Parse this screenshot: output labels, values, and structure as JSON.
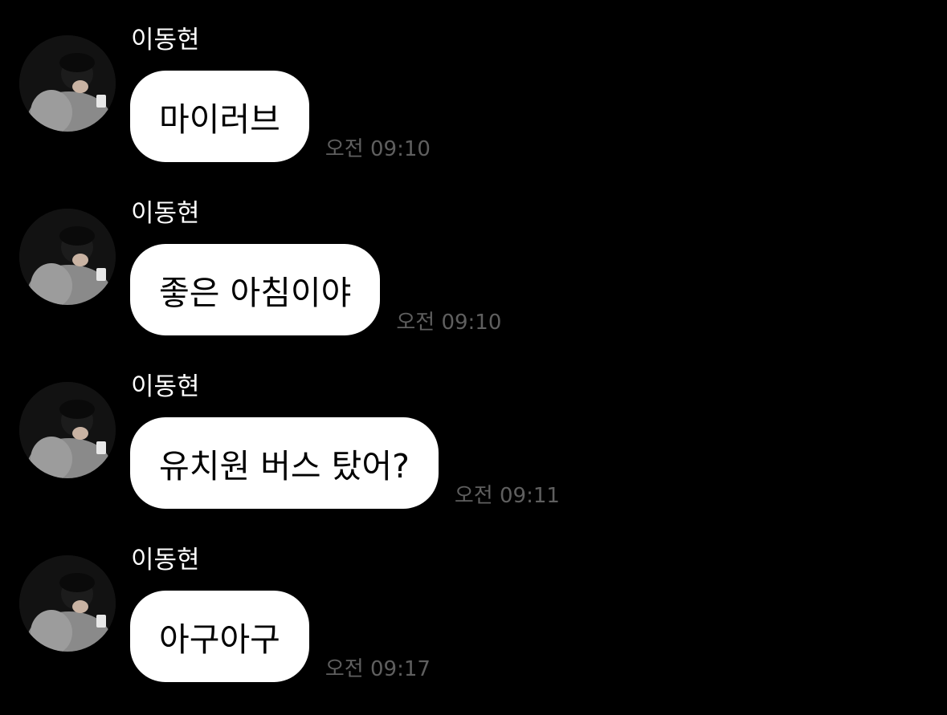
{
  "messages": [
    {
      "sender": "이동현",
      "text": "마이러브",
      "time": "오전 09:10",
      "avatar": "profile-photo"
    },
    {
      "sender": "이동현",
      "text": "좋은 아침이야",
      "time": "오전 09:10",
      "avatar": "profile-photo"
    },
    {
      "sender": "이동현",
      "text": "유치원 버스 탔어?",
      "time": "오전 09:11",
      "avatar": "profile-photo"
    },
    {
      "sender": "이동현",
      "text": "아구아구",
      "time": "오전 09:17",
      "avatar": "profile-photo"
    }
  ],
  "colors": {
    "background": "#000000",
    "bubble": "#ffffff",
    "bubble_text": "#000000",
    "sender_text": "#ffffff",
    "time_text": "#5f5f5f"
  }
}
